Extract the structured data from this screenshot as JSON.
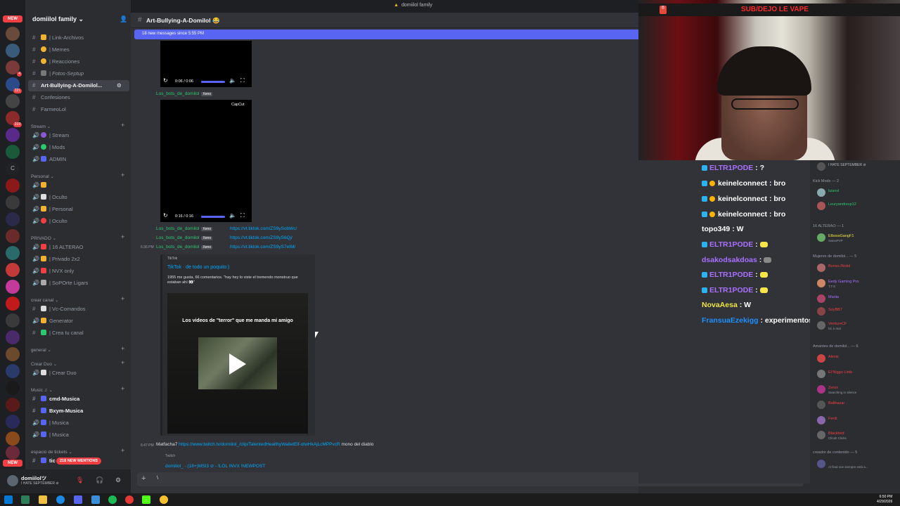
{
  "app": {
    "window_title": "domiilol family",
    "new_messages_bar": "18 new messages since 5:55 PM",
    "new_mentions": "218 NEW MENTIONS"
  },
  "rail": {
    "new_label": "NEW",
    "new_label_bottom": "NEW",
    "servers": [
      "",
      "",
      "",
      "",
      "",
      "",
      "",
      "",
      "",
      "",
      "",
      "",
      "",
      "",
      "",
      "",
      "",
      "",
      "",
      "",
      "",
      "",
      "",
      "",
      "",
      "",
      "",
      "",
      "",
      "",
      "",
      "",
      "",
      "",
      ""
    ]
  },
  "guild": {
    "name": "domiilol family ⌄"
  },
  "channels": {
    "items": [
      {
        "label": "| Link-Archivos"
      },
      {
        "label": "| Memes"
      },
      {
        "label": "| Reacciones"
      },
      {
        "label": "| Fotos-Septup"
      },
      {
        "label": "Art-Bullying-A-Domilol..."
      },
      {
        "label": "Confesiones"
      },
      {
        "label": "FarmeoLol"
      }
    ],
    "cat_stream": "Stream ⌄",
    "stream_items": [
      {
        "label": "| Stream"
      },
      {
        "label": "| Mods"
      },
      {
        "label": "ADMIN"
      }
    ],
    "cat_personal": "Personal ⌄",
    "personal_items": [
      {
        "label": ""
      },
      {
        "label": "| Oculto"
      },
      {
        "label": "| Personal"
      },
      {
        "label": "| Oculto"
      }
    ],
    "cat_privado": "PRIVADO ⌄",
    "privado_items": [
      {
        "label": "| 16 ALTERAO"
      },
      {
        "label": "| Privado 2x2"
      },
      {
        "label": "| NVX only"
      },
      {
        "label": "| SoPOrte Ligars"
      }
    ],
    "cat_crear": "crear canal ⌄",
    "crear_items": [
      {
        "label": "| Vc-Comandos"
      },
      {
        "label": "Generator"
      },
      {
        "label": "| Crea tu canal"
      }
    ],
    "cat_general": "general ⌄",
    "cat_duo": "Crear Duo ⌄",
    "duo_items": [
      {
        "label": "| Crear Duo"
      }
    ],
    "cat_music": "Music ♫ ⌄",
    "music_items": [
      {
        "label": "cmd-Musica"
      },
      {
        "label": "Bxym-Musica"
      },
      {
        "label": "| Musica"
      },
      {
        "label": "| Musica"
      }
    ],
    "cat_tickets": "espacio de tickets ⌄",
    "tickets_partial": "tic"
  },
  "user": {
    "name": "domiilolツ",
    "status": "I HATE SEPTEMBER ⊘"
  },
  "header": {
    "channel": "Art-Bullying-A-Domilol 😂"
  },
  "messages": {
    "v1_time": "0:06 / 0:06",
    "author": "Los_bots_de_domilol",
    "tag": "Xeno",
    "v2_time": "0:16 / 0:16",
    "capcut": "CapCut",
    "links": [
      "https://vt.tiktok.com/ZS9ySobWc/",
      "https://vt.tiktok.com/ZS9yS6Qj/",
      "https://vt.tiktok.com/ZS9yS7eIM/"
    ],
    "t1": "6:36 PM",
    "embed_provider": "TikTok",
    "embed_title": "TikTok · de todo un poquito:)",
    "embed_desc": "1955 me gusta, 66 comentarios. \"hay hey lo viste el tremendo monstruo que estaban ahí 👀\"",
    "thumb_caption": "Los videos de \"terror\" que me manda mi amigo",
    "t2": "6:47 PM",
    "clip_author": "Matfacha7",
    "clip_link": "https://www.twitch.tv/domiilol_/clip/TalentedHealthyWalletElf-otwHkAjLcMPPvcR",
    "clip_suffix": "mono del diablo",
    "twitch_provider": "Twitch",
    "twitch_title": "domiilol_ - (18+)MSI3 ⊘ - !LOL INVX !NEWPOST"
  },
  "composer": {
    "value": "\\"
  },
  "cam": {
    "banner": "SUB/DEJO LE VAPE",
    "badge": "6"
  },
  "chat": [
    {
      "user": "ELTR1PODE",
      "text": ": ?"
    },
    {
      "user": "keinelconnect",
      "text": ": bro"
    },
    {
      "user": "keinelconnect",
      "text": ": bro"
    },
    {
      "user": "keinelconnect",
      "text": ": bro"
    },
    {
      "user": "topo349",
      "text": ": W"
    },
    {
      "user": "ELTR1PODE",
      "text": ":"
    },
    {
      "user": "dsakodsakdoas",
      "text": ":"
    },
    {
      "user": "ELTR1PODE",
      "text": ":"
    },
    {
      "user": "ELTR1PODE",
      "text": ":"
    },
    {
      "user": "NovaAesa",
      "text": ": W"
    },
    {
      "user": "FransuaEzekigg",
      "text": ": experimentos de rd"
    }
  ],
  "members": {
    "top_status": "I HATE SEPTEMBER ⊘",
    "cat_kick": "Kick Mods — 2",
    "kick": [
      {
        "name": "luisnvl",
        "sub": ""
      },
      {
        "name": "Leuryandresp12",
        "sub": ""
      }
    ],
    "cat_alterao": "16 ALTERAO — 1",
    "alterao": [
      {
        "name": "ElbossGangF1",
        "sub": "SwissPVP"
      }
    ],
    "cat_mujeres": "Mujeres de domilol... — 5",
    "mujeres": [
      {
        "name": "Bonso.INolol",
        "sub": ""
      },
      {
        "name": "Eedy Gaming Pro",
        "sub": "T.T.S"
      },
      {
        "name": "Mariia",
        "sub": ""
      },
      {
        "name": "SoyBB7",
        "sub": ""
      },
      {
        "name": "VentureCF",
        "sub": "lol, k mal"
      }
    ],
    "cat_amantes": "Amantes de domilol... — 6",
    "amantes": [
      {
        "name": "Alexis",
        "sub": ""
      },
      {
        "name": "El Niggo Limb",
        "sub": ""
      },
      {
        "name": "Zerox",
        "sub": "Searching in silence"
      },
      {
        "name": "Balthazar",
        "sub": ""
      },
      {
        "name": "Ferdi",
        "sub": ""
      },
      {
        "name": "Blackbird",
        "sub": "Clicah Clicks"
      }
    ],
    "cat_creador": "creador de contenido — 5",
    "creador": [
      {
        "name": "",
        "sub": "Al final soe siempre está a..."
      },
      {
        "name": "",
        "sub": ""
      }
    ]
  },
  "taskbar": {
    "time": "6:50 PM",
    "date": "4/29/2026"
  },
  "colors": {
    "accent": "#5865f2",
    "mention": "#f23f43",
    "link": "#00a8fc",
    "bot_name": "#2dc770",
    "banner_text": "#ff2b2b"
  }
}
